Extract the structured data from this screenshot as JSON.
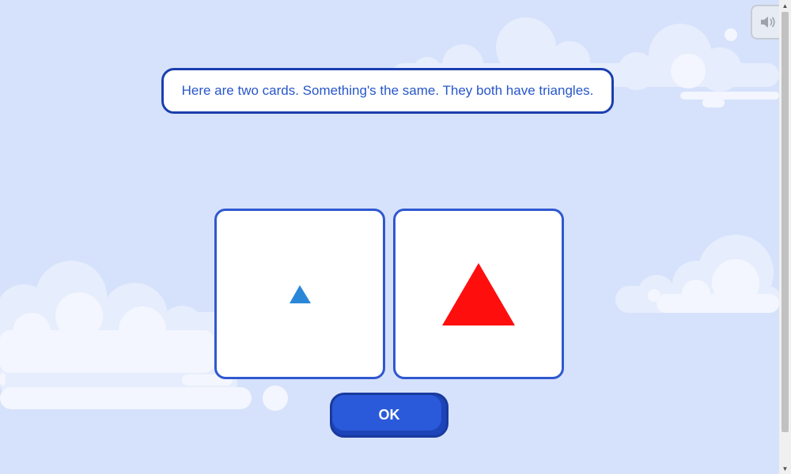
{
  "speech": {
    "text": "Here are two cards. Something's the same. They both have triangles."
  },
  "cards": [
    {
      "shape": "triangle",
      "size": "small",
      "color": "#2a87d8"
    },
    {
      "shape": "triangle",
      "size": "large",
      "color": "#ff0e0e"
    }
  ],
  "ok_button": {
    "label": "OK"
  },
  "sound_button": {
    "icon": "speaker-icon"
  },
  "colors": {
    "background": "#d6e2fb",
    "cloud": "#e8effd",
    "accent": "#2a5ad9",
    "border": "#1b3fae"
  }
}
